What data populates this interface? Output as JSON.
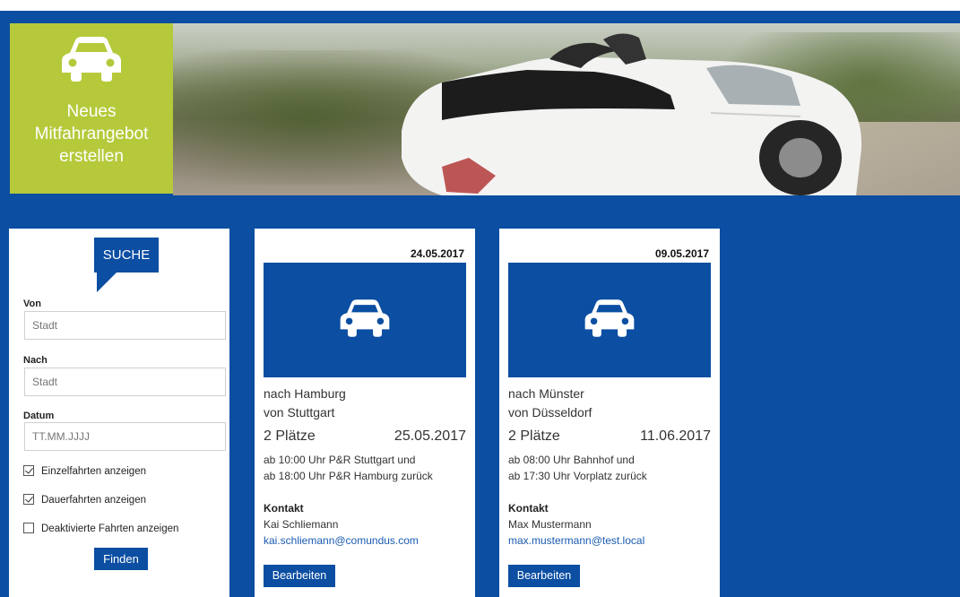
{
  "new_offer": {
    "label": "Neues\nMitfahrangebot\nerstellen",
    "icon": "car-icon"
  },
  "search": {
    "badge": "SUCHE",
    "from_label": "Von",
    "from_placeholder": "Stadt",
    "to_label": "Nach",
    "to_placeholder": "Stadt",
    "date_label": "Datum",
    "date_placeholder": "TT.MM.JJJJ",
    "options": [
      {
        "label": "Einzelfahrten anzeigen",
        "checked": true
      },
      {
        "label": "Dauerfahrten anzeigen",
        "checked": true
      },
      {
        "label": "Deaktivierte Fahrten anzeigen",
        "checked": false
      }
    ],
    "submit": "Finden"
  },
  "rides": [
    {
      "date": "24.05.2017",
      "to": "nach Hamburg",
      "from": "von Stuttgart",
      "seats": "2 Plätze",
      "ride_date": "25.05.2017",
      "line1": "ab 10:00 Uhr P&R Stuttgart und",
      "line2": "ab 18:00 Uhr P&R Hamburg zurück",
      "contact_heading": "Kontakt",
      "contact_name": "Kai Schliemann",
      "contact_email": "kai.schliemann@comundus.com",
      "edit": "Bearbeiten"
    },
    {
      "date": "09.05.2017",
      "to": "nach Münster",
      "from": "von Düsseldorf",
      "seats": "2 Plätze",
      "ride_date": "11.06.2017",
      "line1": "ab 08:00 Uhr Bahnhof und",
      "line2": "ab 17:30 Uhr Vorplatz zurück",
      "contact_heading": "Kontakt",
      "contact_name": "Max Mustermann",
      "contact_email": "max.mustermann@test.local",
      "edit": "Bearbeiten"
    }
  ],
  "colors": {
    "primary": "#0b4ea2",
    "accent": "#b6c93b",
    "link": "#1a5bb0"
  }
}
